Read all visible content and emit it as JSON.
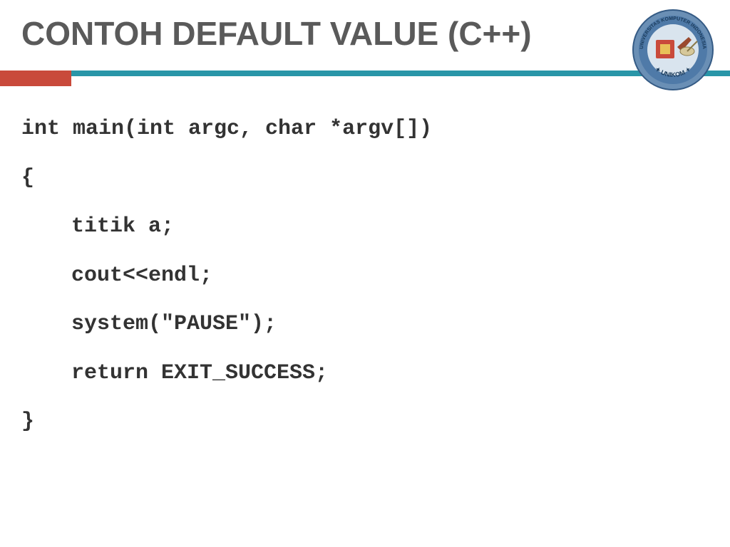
{
  "slide": {
    "title": "CONTOH DEFAULT VALUE (C++)",
    "logo_text_top": "UNIVERSITAS KOMPUTER INDONESIA",
    "logo_text_bottom": "UNIKOM"
  },
  "code": {
    "line1": "int main(int argc, char *argv[])",
    "line2": "{",
    "line3": "titik a;",
    "line4": "cout<<endl;",
    "line5": "system(\"PAUSE\");",
    "line6": "return EXIT_SUCCESS;",
    "line7": "}"
  },
  "colors": {
    "title": "#5a5a5a",
    "accent_red": "#c94a3b",
    "accent_teal": "#2996a8"
  }
}
